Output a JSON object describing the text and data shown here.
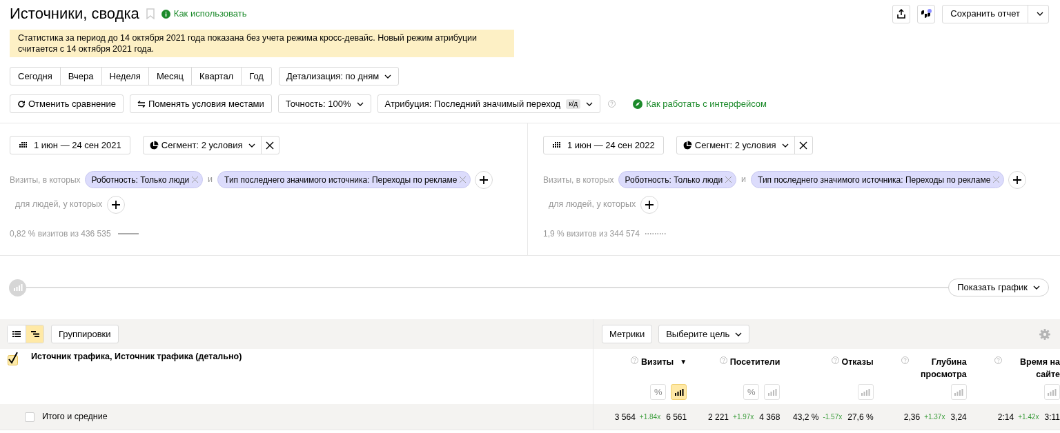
{
  "header": {
    "title": "Источники, сводка",
    "help_link": "Как использовать",
    "save_button": "Сохранить отчет"
  },
  "notice": "Статистика за период до 14 октября 2021 года показана без учета режима кросс-девайс. Новый режим атрибуции считается с 14 октября 2021 года.",
  "periods": [
    "Сегодня",
    "Вчера",
    "Неделя",
    "Месяц",
    "Квартал",
    "Год"
  ],
  "detail_dropdown": "Детализация: по дням",
  "toolbar": {
    "cancel_compare": "Отменить сравнение",
    "swap": "Поменять условия местами",
    "accuracy": "Точность: 100%",
    "attribution": "Атрибуция: Последний значимый переход",
    "attribution_badge": "к/д",
    "help_link": "Как работать с интерфейсом"
  },
  "segments": [
    {
      "date": "1 июн — 24 сен 2021",
      "segment": "Сегмент: 2 условия",
      "visits_label": "Визиты, в которых",
      "conditions": [
        "Роботность: Только люди",
        "Тип последнего значимого источника: Переходы по рекламе"
      ],
      "joiner": "и",
      "people_label": "для людей, у которых",
      "summary": "0,82 % визитов из 436 535",
      "kind": "solid"
    },
    {
      "date": "1 июн — 24 сен 2022",
      "segment": "Сегмент: 2 условия",
      "visits_label": "Визиты, в которых",
      "conditions": [
        "Роботность: Только люди",
        "Тип последнего значимого источника: Переходы по рекламе"
      ],
      "joiner": "и",
      "people_label": "для людей, у которых",
      "summary": "1,9 % визитов из 344 574",
      "kind": "dotted"
    }
  ],
  "chart_toggle": "Показать график",
  "table": {
    "view_buttons": [
      {
        "kind": "list",
        "selected": false
      },
      {
        "kind": "tree",
        "selected": true
      }
    ],
    "groupings_button": "Группировки",
    "metrics_button": "Метрики",
    "goal_dropdown": "Выберите цель",
    "grouping": {
      "label": "Источник трафика, Источник трафика (детально)",
      "checked": true
    },
    "columns": [
      {
        "label": "Визиты",
        "sort": "▼",
        "percent_button": "%",
        "chart_selected": true
      },
      {
        "label": "Посетители",
        "percent_button": "%",
        "chart_selected": false
      },
      {
        "label": "Отказы",
        "chart_selected": false
      },
      {
        "label": "Глубина просмотра",
        "chart_selected": false
      },
      {
        "label": "Время на сайте",
        "chart_selected": false
      }
    ],
    "totals": {
      "label": "Итого и средние",
      "checked": false,
      "cells": [
        {
          "value": "3 564",
          "change": "+1.84x",
          "compare": "6 561"
        },
        {
          "value": "2 221",
          "change": "+1.97x",
          "compare": "4 368"
        },
        {
          "value": "43,2 %",
          "change": "-1.57x",
          "compare": "27,6 %"
        },
        {
          "value": "2,36",
          "change": "+1.37x",
          "compare": "3,24"
        },
        {
          "value": "2:14",
          "change": "+1.42x",
          "compare": "3:11"
        }
      ]
    }
  }
}
